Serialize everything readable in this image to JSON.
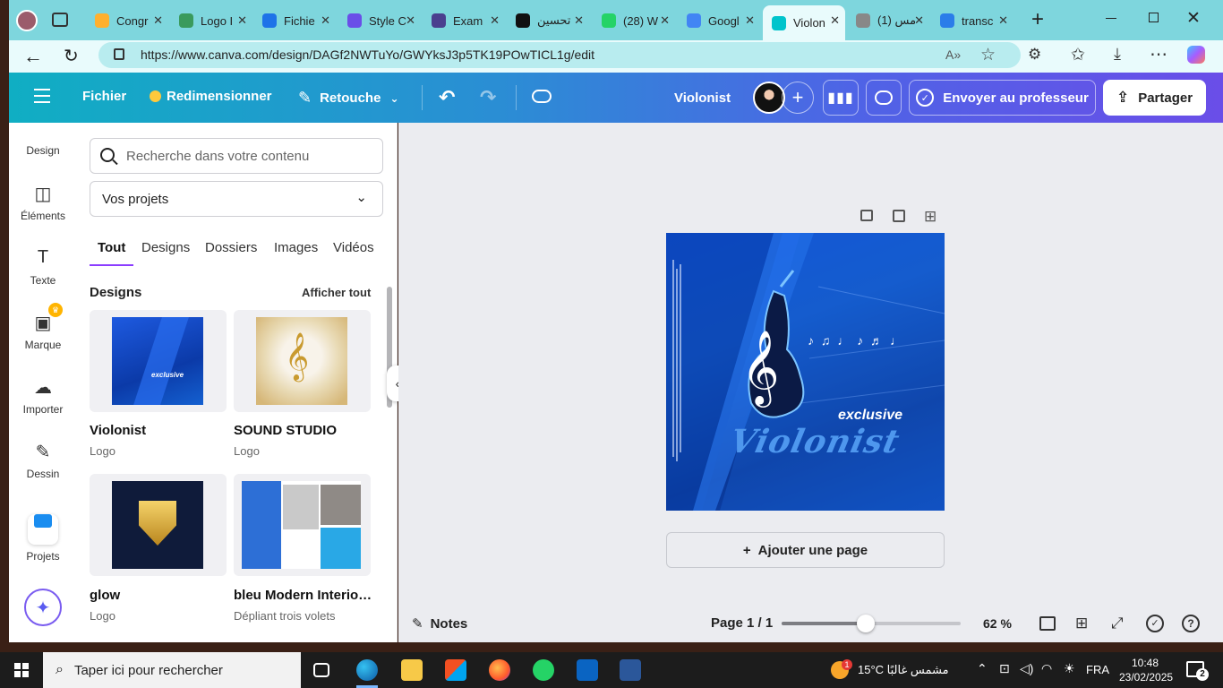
{
  "browser": {
    "tabs": [
      {
        "label": "Congr",
        "color": "#ffb02e"
      },
      {
        "label": "Logo I",
        "color": "#3a9a5c"
      },
      {
        "label": "Fichie",
        "color": "#1e73e8"
      },
      {
        "label": "Style C",
        "color": "#6a4ee8"
      },
      {
        "label": "Exam",
        "color": "#4a3f8f"
      },
      {
        "label": "تحسين",
        "color": "#111111"
      },
      {
        "label": "(28) W",
        "color": "#25d366"
      },
      {
        "label": "Googl",
        "color": "#4285f4"
      },
      {
        "label": "Violon",
        "color": "#00c4cc"
      },
      {
        "label": "(1) مس",
        "color": "#888888"
      },
      {
        "label": "transc",
        "color": "#2b7de9"
      }
    ],
    "url": "https://www.canva.com/design/DAGf2NWTuYo/GWYksJ3p5TK19POwTICL1g/edit"
  },
  "header": {
    "file": "Fichier",
    "resize": "Redimensionner",
    "retouch": "Retouche",
    "title": "Violonist",
    "send": "Envoyer au professeur",
    "share": "Partager"
  },
  "rail": [
    {
      "label": "Design",
      "icon": "design-icon"
    },
    {
      "label": "Éléments",
      "icon": "elements-icon"
    },
    {
      "label": "Texte",
      "icon": "text-icon"
    },
    {
      "label": "Marque",
      "icon": "brand-icon"
    },
    {
      "label": "Importer",
      "icon": "upload-icon"
    },
    {
      "label": "Dessin",
      "icon": "draw-icon"
    },
    {
      "label": "Projets",
      "icon": "projects-icon"
    }
  ],
  "panel": {
    "search_placeholder": "Recherche dans votre contenu",
    "select_value": "Vos projets",
    "tabs": [
      "Tout",
      "Designs",
      "Dossiers",
      "Images",
      "Vidéos"
    ],
    "section_title": "Designs",
    "see_all": "Afficher tout",
    "cards": [
      {
        "title": "Violonist",
        "sub": "Logo"
      },
      {
        "title": "SOUND STUDIO",
        "sub": "Logo"
      },
      {
        "title": "glow",
        "sub": "Logo"
      },
      {
        "title": "bleu Modern Interior...",
        "sub": "Dépliant trois volets"
      }
    ]
  },
  "canvas": {
    "logo_text_small": "exclusive",
    "logo_text_big": "Violonist",
    "add_page": "Ajouter une page"
  },
  "footer": {
    "notes": "Notes",
    "page": "Page 1 / 1",
    "zoom": "62 %",
    "zoom_value": 62
  },
  "taskbar": {
    "search": "Taper ici pour rechercher",
    "weather": "15°C  مشمس غالبًا",
    "lang": "FRA",
    "time": "10:48",
    "date": "23/02/2025",
    "notif": "2",
    "weather_badge": "1"
  }
}
